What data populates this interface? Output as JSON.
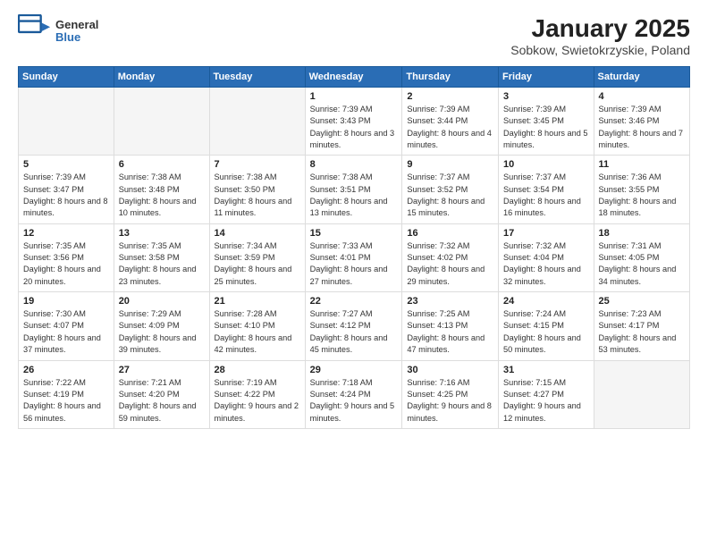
{
  "logo": {
    "general": "General",
    "blue": "Blue"
  },
  "title": "January 2025",
  "subtitle": "Sobkow, Swietokrzyskie, Poland",
  "days_header": [
    "Sunday",
    "Monday",
    "Tuesday",
    "Wednesday",
    "Thursday",
    "Friday",
    "Saturday"
  ],
  "weeks": [
    [
      {
        "num": "",
        "info": ""
      },
      {
        "num": "",
        "info": ""
      },
      {
        "num": "",
        "info": ""
      },
      {
        "num": "1",
        "info": "Sunrise: 7:39 AM\nSunset: 3:43 PM\nDaylight: 8 hours and 3 minutes."
      },
      {
        "num": "2",
        "info": "Sunrise: 7:39 AM\nSunset: 3:44 PM\nDaylight: 8 hours and 4 minutes."
      },
      {
        "num": "3",
        "info": "Sunrise: 7:39 AM\nSunset: 3:45 PM\nDaylight: 8 hours and 5 minutes."
      },
      {
        "num": "4",
        "info": "Sunrise: 7:39 AM\nSunset: 3:46 PM\nDaylight: 8 hours and 7 minutes."
      }
    ],
    [
      {
        "num": "5",
        "info": "Sunrise: 7:39 AM\nSunset: 3:47 PM\nDaylight: 8 hours and 8 minutes."
      },
      {
        "num": "6",
        "info": "Sunrise: 7:38 AM\nSunset: 3:48 PM\nDaylight: 8 hours and 10 minutes."
      },
      {
        "num": "7",
        "info": "Sunrise: 7:38 AM\nSunset: 3:50 PM\nDaylight: 8 hours and 11 minutes."
      },
      {
        "num": "8",
        "info": "Sunrise: 7:38 AM\nSunset: 3:51 PM\nDaylight: 8 hours and 13 minutes."
      },
      {
        "num": "9",
        "info": "Sunrise: 7:37 AM\nSunset: 3:52 PM\nDaylight: 8 hours and 15 minutes."
      },
      {
        "num": "10",
        "info": "Sunrise: 7:37 AM\nSunset: 3:54 PM\nDaylight: 8 hours and 16 minutes."
      },
      {
        "num": "11",
        "info": "Sunrise: 7:36 AM\nSunset: 3:55 PM\nDaylight: 8 hours and 18 minutes."
      }
    ],
    [
      {
        "num": "12",
        "info": "Sunrise: 7:35 AM\nSunset: 3:56 PM\nDaylight: 8 hours and 20 minutes."
      },
      {
        "num": "13",
        "info": "Sunrise: 7:35 AM\nSunset: 3:58 PM\nDaylight: 8 hours and 23 minutes."
      },
      {
        "num": "14",
        "info": "Sunrise: 7:34 AM\nSunset: 3:59 PM\nDaylight: 8 hours and 25 minutes."
      },
      {
        "num": "15",
        "info": "Sunrise: 7:33 AM\nSunset: 4:01 PM\nDaylight: 8 hours and 27 minutes."
      },
      {
        "num": "16",
        "info": "Sunrise: 7:32 AM\nSunset: 4:02 PM\nDaylight: 8 hours and 29 minutes."
      },
      {
        "num": "17",
        "info": "Sunrise: 7:32 AM\nSunset: 4:04 PM\nDaylight: 8 hours and 32 minutes."
      },
      {
        "num": "18",
        "info": "Sunrise: 7:31 AM\nSunset: 4:05 PM\nDaylight: 8 hours and 34 minutes."
      }
    ],
    [
      {
        "num": "19",
        "info": "Sunrise: 7:30 AM\nSunset: 4:07 PM\nDaylight: 8 hours and 37 minutes."
      },
      {
        "num": "20",
        "info": "Sunrise: 7:29 AM\nSunset: 4:09 PM\nDaylight: 8 hours and 39 minutes."
      },
      {
        "num": "21",
        "info": "Sunrise: 7:28 AM\nSunset: 4:10 PM\nDaylight: 8 hours and 42 minutes."
      },
      {
        "num": "22",
        "info": "Sunrise: 7:27 AM\nSunset: 4:12 PM\nDaylight: 8 hours and 45 minutes."
      },
      {
        "num": "23",
        "info": "Sunrise: 7:25 AM\nSunset: 4:13 PM\nDaylight: 8 hours and 47 minutes."
      },
      {
        "num": "24",
        "info": "Sunrise: 7:24 AM\nSunset: 4:15 PM\nDaylight: 8 hours and 50 minutes."
      },
      {
        "num": "25",
        "info": "Sunrise: 7:23 AM\nSunset: 4:17 PM\nDaylight: 8 hours and 53 minutes."
      }
    ],
    [
      {
        "num": "26",
        "info": "Sunrise: 7:22 AM\nSunset: 4:19 PM\nDaylight: 8 hours and 56 minutes."
      },
      {
        "num": "27",
        "info": "Sunrise: 7:21 AM\nSunset: 4:20 PM\nDaylight: 8 hours and 59 minutes."
      },
      {
        "num": "28",
        "info": "Sunrise: 7:19 AM\nSunset: 4:22 PM\nDaylight: 9 hours and 2 minutes."
      },
      {
        "num": "29",
        "info": "Sunrise: 7:18 AM\nSunset: 4:24 PM\nDaylight: 9 hours and 5 minutes."
      },
      {
        "num": "30",
        "info": "Sunrise: 7:16 AM\nSunset: 4:25 PM\nDaylight: 9 hours and 8 minutes."
      },
      {
        "num": "31",
        "info": "Sunrise: 7:15 AM\nSunset: 4:27 PM\nDaylight: 9 hours and 12 minutes."
      },
      {
        "num": "",
        "info": ""
      }
    ]
  ]
}
